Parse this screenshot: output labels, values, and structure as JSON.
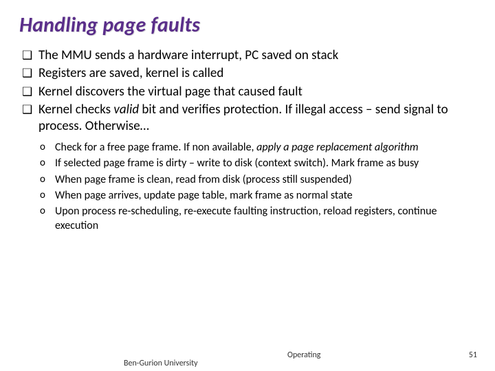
{
  "title": "Handling page faults",
  "bullets": {
    "b0": "The MMU sends a hardware interrupt, PC saved on stack",
    "b1": "Registers are saved, kernel is called",
    "b2": "Kernel discovers the virtual page that caused fault",
    "b3_pre": "Kernel checks ",
    "b3_em": "valid",
    "b3_post": " bit and verifies protection. If illegal access – send signal to process. Otherwise…"
  },
  "sub": {
    "s0_pre": "Check for a free page frame. If non available, ",
    "s0_em": "apply a page replacement algorithm",
    "s1": "If selected page frame is dirty – write to disk (context switch). Mark frame as busy",
    "s2": "When page frame is clean, read from disk (process still suspended)",
    "s3": "When page arrives, update page table, mark frame as normal state",
    "s4": "Upon process re-scheduling, re-execute faulting instruction, reload registers, continue execution"
  },
  "footer": {
    "left": "Ben-Gurion University",
    "center": "Operating",
    "right": "51"
  }
}
